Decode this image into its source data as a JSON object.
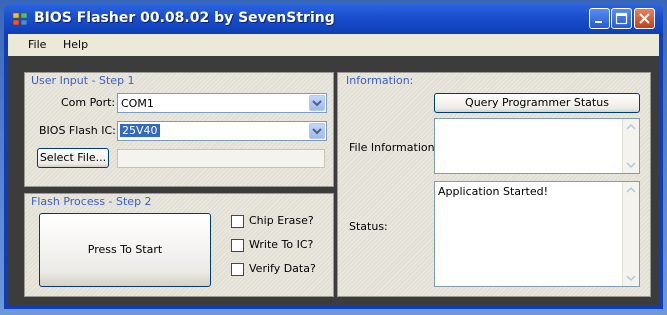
{
  "window": {
    "title": "BIOS Flasher 00.08.02 by SevenString"
  },
  "menu": {
    "items": [
      {
        "label": "File"
      },
      {
        "label": "Help"
      }
    ]
  },
  "user_input": {
    "title": "User Input - Step 1",
    "com_port_label": "Com Port:",
    "com_port_value": "COM1",
    "flash_ic_label": "BIOS Flash IC:",
    "flash_ic_value": "25V40",
    "select_file_label": "Select File...",
    "file_path_value": ""
  },
  "flash_process": {
    "title": "Flash Process - Step 2",
    "start_label": "Press To Start",
    "options": [
      {
        "label": "Chip Erase?",
        "checked": false
      },
      {
        "label": "Write To IC?",
        "checked": false
      },
      {
        "label": "Verify Data?",
        "checked": false
      }
    ]
  },
  "information": {
    "title": "Information:",
    "query_label": "Query Programmer Status",
    "file_info_label": "File Information:",
    "file_info_value": "",
    "status_label": "Status:",
    "status_value": "Application Started!"
  },
  "colors": {
    "group_title": "#3a5fcd",
    "titlebar": "#1b4fcf",
    "selection": "#316ac5"
  },
  "icons": {
    "app": "app-icon",
    "minimize": "minimize-icon",
    "maximize": "maximize-icon",
    "close": "close-icon",
    "dropdown": "chevron-down-icon"
  }
}
